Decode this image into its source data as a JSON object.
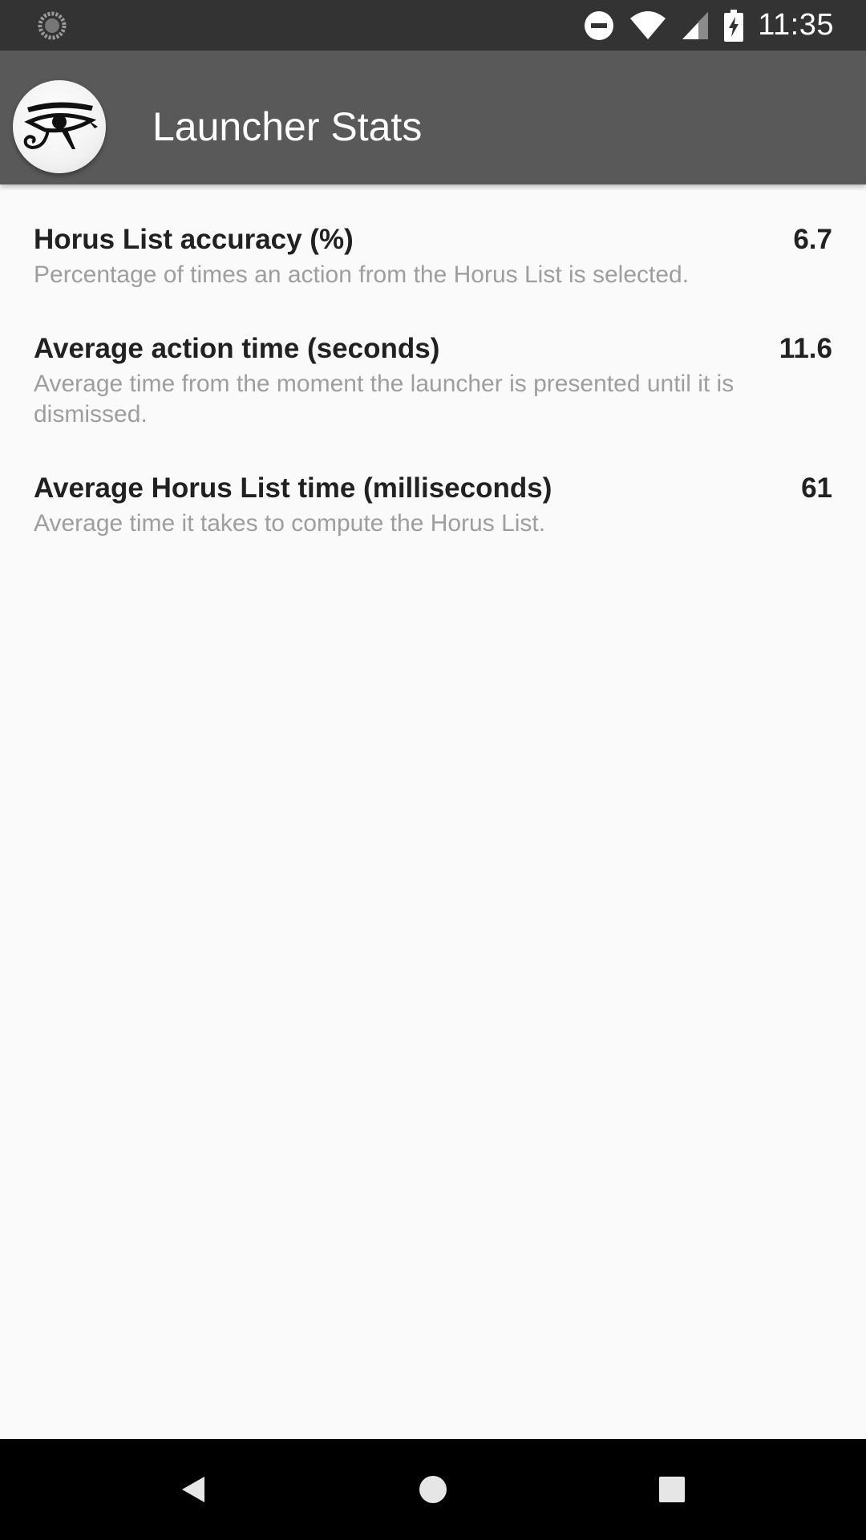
{
  "status_bar": {
    "time": "11:35",
    "icons": [
      "sync-icon",
      "do-not-disturb-icon",
      "wifi-icon",
      "signal-icon",
      "battery-charging-icon"
    ]
  },
  "app_bar": {
    "title": "Launcher Stats",
    "logo_icon": "eye-of-horus-icon",
    "background": "#595959"
  },
  "stats": [
    {
      "title": "Horus List accuracy (%)",
      "value": "6.7",
      "description": "Percentage of times an action from the Horus List is selected."
    },
    {
      "title": "Average action time (seconds)",
      "value": "11.6",
      "description": "Average time from the moment the launcher is presented until it is dismissed."
    },
    {
      "title": "Average Horus List time (milliseconds)",
      "value": "61",
      "description": "Average time it takes to compute the Horus List."
    }
  ],
  "nav_bar": {
    "icons": [
      "back-icon",
      "home-icon",
      "recents-icon"
    ]
  },
  "colors": {
    "status_bar": "#333333",
    "app_bar": "#595959",
    "background": "#fafafa",
    "title_text": "#212121",
    "description_text": "#9e9e9e"
  }
}
